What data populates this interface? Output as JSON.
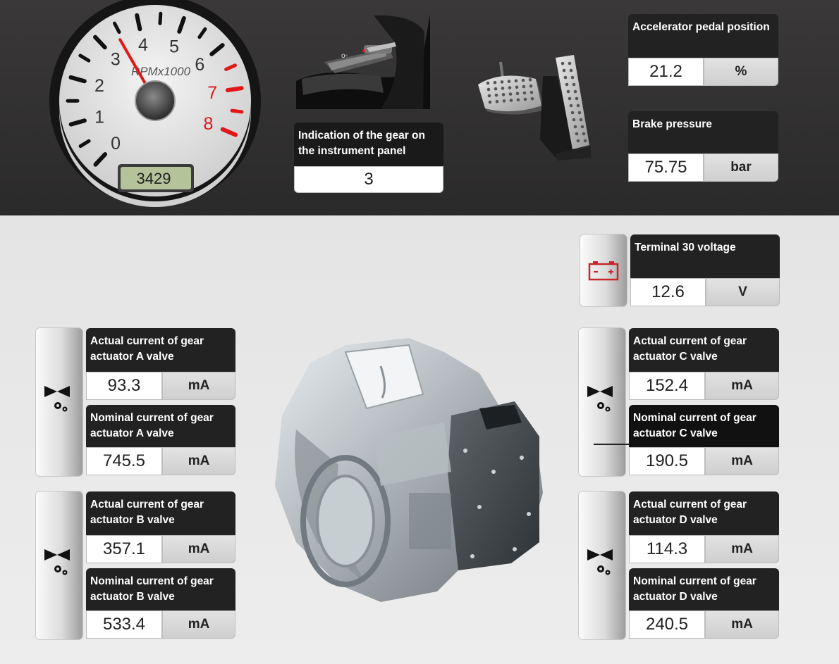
{
  "tachometer": {
    "dial_label": "RPMx1000",
    "ticks": [
      "0",
      "1",
      "2",
      "3",
      "4",
      "5",
      "6",
      "7",
      "8"
    ],
    "rpm_display": "3429",
    "rpm_value": 3429
  },
  "gear": {
    "label": "Indication of the gear on the instrument panel",
    "value": "3"
  },
  "accelerator": {
    "label": "Accelerator pedal position",
    "value": "21.2",
    "unit": "%"
  },
  "brake": {
    "label": "Brake pressure",
    "value": "75.75",
    "unit": "bar"
  },
  "terminal30": {
    "label": "Terminal 30 voltage",
    "value": "12.6",
    "unit": "V"
  },
  "actuator_a": {
    "actual_label": "Actual current of gear actuator A valve",
    "actual_value": "93.3",
    "actual_unit": "mA",
    "nominal_label": "Nominal current of gear actuator A valve",
    "nominal_value": "745.5",
    "nominal_unit": "mA"
  },
  "actuator_b": {
    "actual_label": "Actual current of gear actuator B valve",
    "actual_value": "357.1",
    "actual_unit": "mA",
    "nominal_label": "Nominal current of gear actuator B valve",
    "nominal_value": "533.4",
    "nominal_unit": "mA"
  },
  "actuator_c": {
    "actual_label": "Actual current of gear actuator C valve",
    "actual_value": "152.4",
    "actual_unit": "mA",
    "nominal_label": "Nominal current of gear actuator C valve",
    "nominal_value": "190.5",
    "nominal_unit": "mA"
  },
  "actuator_d": {
    "actual_label": "Actual current of gear actuator D valve",
    "actual_value": "114.3",
    "actual_unit": "mA",
    "nominal_label": "Nominal current of gear actuator D valve",
    "nominal_value": "240.5",
    "nominal_unit": "mA"
  }
}
